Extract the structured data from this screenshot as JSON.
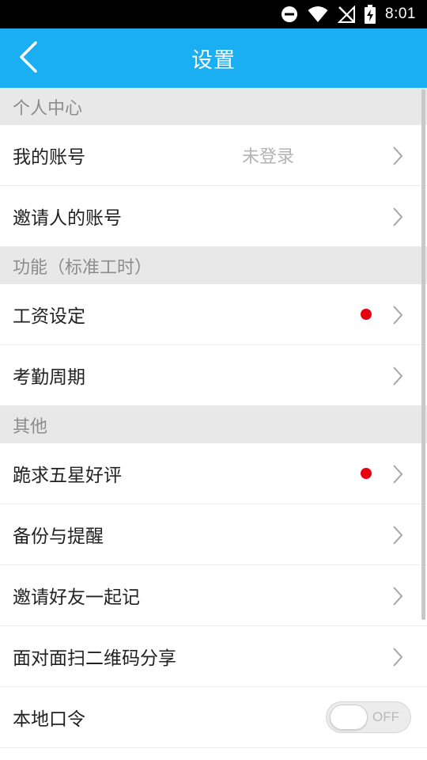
{
  "status_bar": {
    "time": "8:01",
    "icons": [
      "do-not-disturb-icon",
      "wifi-icon",
      "no-signal-icon",
      "battery-charging-icon"
    ]
  },
  "app_bar": {
    "title": "设置",
    "back_icon": "chevron-left-icon",
    "color": "#1aaef3"
  },
  "sections": {
    "personal": {
      "header": "个人中心",
      "my_account": {
        "label": "我的账号",
        "value": "未登录"
      },
      "inviter_account": {
        "label": "邀请人的账号"
      }
    },
    "features": {
      "header": "功能（标准工时）",
      "salary_settings": {
        "label": "工资设定",
        "badge_color": "#e60012"
      },
      "attendance_cycle": {
        "label": "考勤周期"
      }
    },
    "other": {
      "header": "其他",
      "rate_five_stars": {
        "label": "跪求五星好评",
        "badge_color": "#e60012"
      },
      "backup_reminder": {
        "label": "备份与提醒"
      },
      "invite_friends": {
        "label": "邀请好友一起记"
      },
      "qr_share": {
        "label": "面对面扫二维码分享"
      },
      "local_passcode": {
        "label": "本地口令",
        "toggle_text": "OFF"
      }
    }
  }
}
